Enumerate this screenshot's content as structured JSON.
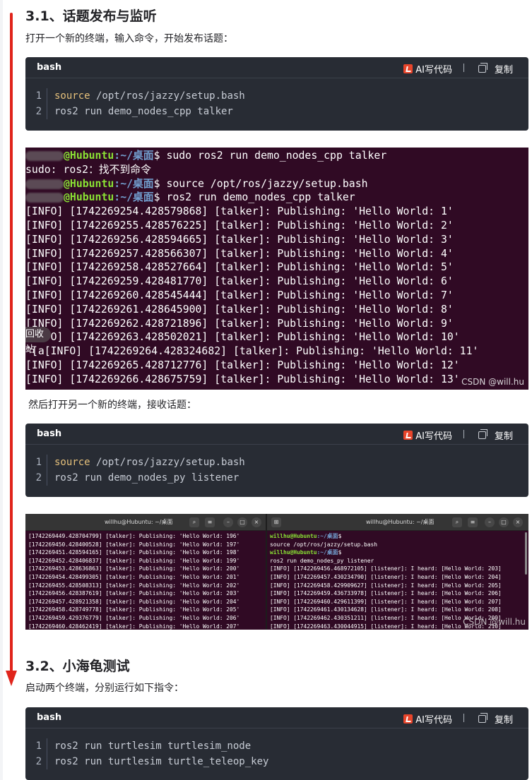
{
  "section1": {
    "title": "3.1、话题发布与监听",
    "intro": "打开一个新的终端，输入命令，开始发布话题："
  },
  "code_toolbar": {
    "ai_label": "AI写代码",
    "copy_label": "复制"
  },
  "code1": {
    "lang": "bash",
    "lines": [
      {
        "num": "1",
        "kw": "source",
        "rest": " /opt/ros/jazzy/setup.bash"
      },
      {
        "num": "2",
        "kw": "",
        "rest": "ros2 run demo_nodes_cpp talker"
      }
    ]
  },
  "terminal1": {
    "prompt_user": "@Hubuntu",
    "prompt_path": ":~/桌面",
    "prompt_end": "$ ",
    "cmd1": "sudo ros2 run demo_nodes_cpp talker",
    "sudo_err": "sudo: ros2：找不到命令",
    "cmd2": "source /opt/ros/jazzy/setup.bash",
    "cmd3": "ros2 run demo_nodes_cpp talker",
    "logs": [
      "[INFO] [1742269254.428579868] [talker]: Publishing: 'Hello World: 1'",
      "[INFO] [1742269255.428576225] [talker]: Publishing: 'Hello World: 2'",
      "[INFO] [1742269256.428594665] [talker]: Publishing: 'Hello World: 3'",
      "[INFO] [1742269257.428566307] [talker]: Publishing: 'Hello World: 4'",
      "[INFO] [1742269258.428527664] [talker]: Publishing: 'Hello World: 5'",
      "[INFO] [1742269259.428481770] [talker]: Publishing: 'Hello World: 6'",
      "[INFO] [1742269260.428545444] [talker]: Publishing: 'Hello World: 7'",
      "[INFO] [1742269261.428645900] [talker]: Publishing: 'Hello World: 8'",
      "[INFO] [1742269262.428721896] [talker]: Publishing: 'Hello World: 9'",
      "[INFO] [1742269263.428502021] [talker]: Publishing: 'Hello World: 10'",
      "^[a[INFO] [1742269264.428324682] [talker]: Publishing: 'Hello World: 11'",
      "[INFO] [1742269265.428712776] [talker]: Publishing: 'Hello World: 12'",
      "[INFO] [1742269266.428675759] [talker]: Publishing: 'Hello World: 13'"
    ],
    "overlay_text": "回收站",
    "watermark": "CSDN @will.hu"
  },
  "intro2": "然后打开另一个新的终端，接收话题：",
  "code2": {
    "lang": "bash",
    "lines": [
      {
        "num": "1",
        "kw": "source",
        "rest": " /opt/ros/jazzy/setup.bash"
      },
      {
        "num": "2",
        "kw": "",
        "rest": "ros2 run demo_nodes_py listener"
      }
    ]
  },
  "twin_terminals": {
    "left_title": "willhu@Hubuntu: ~/桌面",
    "right_title": "willhu@Hubuntu: ~/桌面",
    "left_lines": [
      "[1742269449.428704799] [talker]: Publishing: 'Hello World: 196'",
      "[1742269450.428400528] [talker]: Publishing: 'Hello World: 197'",
      "[1742269451.428594165] [talker]: Publishing: 'Hello World: 198'",
      "[1742269452.428406837] [talker]: Publishing: 'Hello World: 199'",
      "[1742269453.428636863] [talker]: Publishing: 'Hello World: 200'",
      "[1742269454.428499305] [talker]: Publishing: 'Hello World: 201'",
      "[1742269455.428508313] [talker]: Publishing: 'Hello World: 202'",
      "[1742269456.428387619] [talker]: Publishing: 'Hello World: 203'",
      "[1742269457.428921358] [talker]: Publishing: 'Hello World: 204'",
      "[1742269458.428749778] [talker]: Publishing: 'Hello World: 205'",
      "[1742269459.429376779] [talker]: Publishing: 'Hello World: 206'",
      "[1742269460.428462419] [talker]: Publishing: 'Hello World: 207'"
    ],
    "right_prompt_user": "willhu@Hubuntu",
    "right_prompt_path": ":~/桌面",
    "right_lines": [
      "source /opt/ros/jazzy/setup.bash",
      "ros2 run demo_nodes_py listener",
      "[INFO] [1742269456.468972105] [listener]: I heard: [Hello World: 203]",
      "[INFO] [1742269457.430234790] [listener]: I heard: [Hello World: 204]",
      "[INFO] [1742269458.429909627] [listener]: I heard: [Hello World: 205]",
      "[INFO] [1742269459.436733978] [listener]: I heard: [Hello World: 206]",
      "[INFO] [1742269460.429611399] [listener]: I heard: [Hello World: 207]",
      "[INFO] [1742269461.430134628] [listener]: I heard: [Hello World: 208]",
      "[INFO] [1742269462.430351211] [listener]: I heard: [Hello World: 209]",
      "[INFO] [1742269463.430044915] [listener]: I heard: [Hello World: 210]"
    ],
    "watermark": "CSDN @will.hu"
  },
  "section2": {
    "title": "3.2、小海龟测试",
    "intro": "启动两个终端，分别运行如下指令："
  },
  "code3": {
    "lang": "bash",
    "lines": [
      {
        "num": "1",
        "kw": "",
        "rest": "ros2 run turtlesim turtlesim_node"
      },
      {
        "num": "2",
        "kw": "",
        "rest": "ros2 run turtlesim turtle_teleop_key"
      }
    ]
  },
  "colors": {
    "accent_red": "#e0241b",
    "terminal_bg": "#300a24",
    "code_bg": "#282c34",
    "prompt_green": "#8ae234",
    "prompt_blue": "#729fcf"
  }
}
